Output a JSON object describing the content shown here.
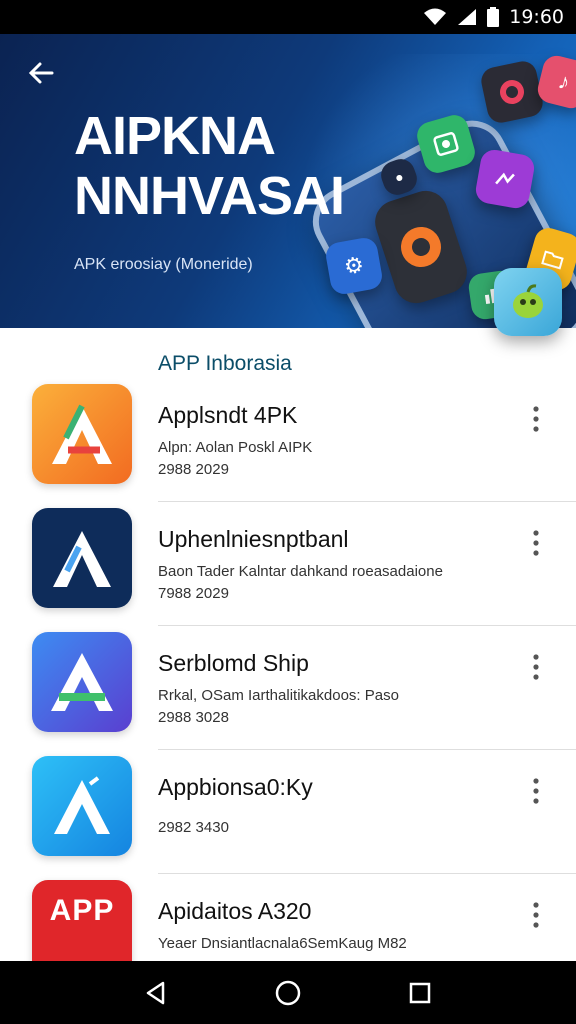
{
  "status_bar": {
    "time": "19:60",
    "icons": [
      "wifi-icon",
      "cell-signal-icon",
      "battery-icon"
    ]
  },
  "hero": {
    "back_icon": "arrow-left-icon",
    "title": "AIPKNA\nNNHVASAI",
    "subtitle": "APK eroosiay (Moneride)",
    "colors": {
      "bg_dark": "#0b2352",
      "bg_light": "#1a79d1"
    }
  },
  "section": {
    "title": "APP Inborasia"
  },
  "apps": [
    {
      "name": "Applsndt 4PK",
      "desc": "Alpn: Aolan Poskl AIPK",
      "meta": "2988  2029",
      "icon": "A",
      "color": "#f7941d"
    },
    {
      "name": "Uphenlniesnptbanl",
      "desc": "Baon Tader Kalntar dahkand roeasadaione",
      "meta": "7988  2029",
      "icon": "A",
      "color": "#0e2c5a"
    },
    {
      "name": "Serblomd Ship",
      "desc": "Rrkal, OSam Iarthalitikakdoos: Paso",
      "meta": "2988  3028",
      "icon": "A",
      "color": "#3c6fe0"
    },
    {
      "name": "Appbionsa0:Ky",
      "desc": "",
      "meta": "2982  3430",
      "icon": "A",
      "color": "#1ca7f0"
    },
    {
      "name": "Apidaitos A320",
      "desc": "Yeaer Dnsiantlacnala6SemKaug M82",
      "meta": "",
      "icon": "APP",
      "color": "#e0262a"
    }
  ],
  "nav": {
    "back": "triangle-back-icon",
    "home": "circle-home-icon",
    "recents": "square-recents-icon"
  }
}
